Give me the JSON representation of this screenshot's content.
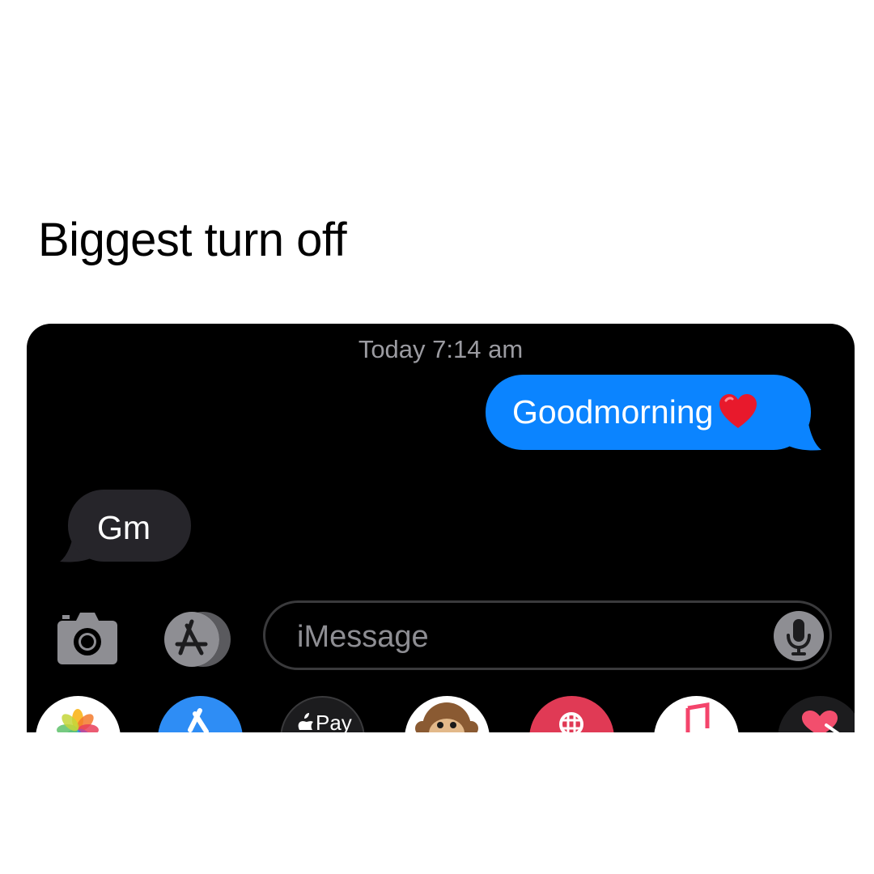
{
  "caption": "Biggest turn off",
  "conversation": {
    "timestamp": "Today 7:14 am",
    "messages": [
      {
        "direction": "outgoing",
        "text": "Goodmorning",
        "emoji": "red-heart"
      },
      {
        "direction": "incoming",
        "text": "Gm"
      }
    ]
  },
  "composer": {
    "placeholder": "iMessage",
    "camera_icon": "camera-icon",
    "apps_icon": "app-store-icon",
    "mic_icon": "microphone-icon"
  },
  "app_drawer": {
    "apps": [
      {
        "name": "photos-app-icon"
      },
      {
        "name": "app-store-app-icon"
      },
      {
        "name": "apple-pay-app-icon",
        "label": "Pay"
      },
      {
        "name": "animoji-monkey-app-icon"
      },
      {
        "name": "web-images-app-icon"
      },
      {
        "name": "music-app-icon"
      },
      {
        "name": "digital-touch-app-icon"
      }
    ]
  },
  "colors": {
    "outgoing_bubble": "#0b84ff",
    "incoming_bubble": "#26252a",
    "background": "#000000",
    "timestamp": "#9b9ba1"
  }
}
